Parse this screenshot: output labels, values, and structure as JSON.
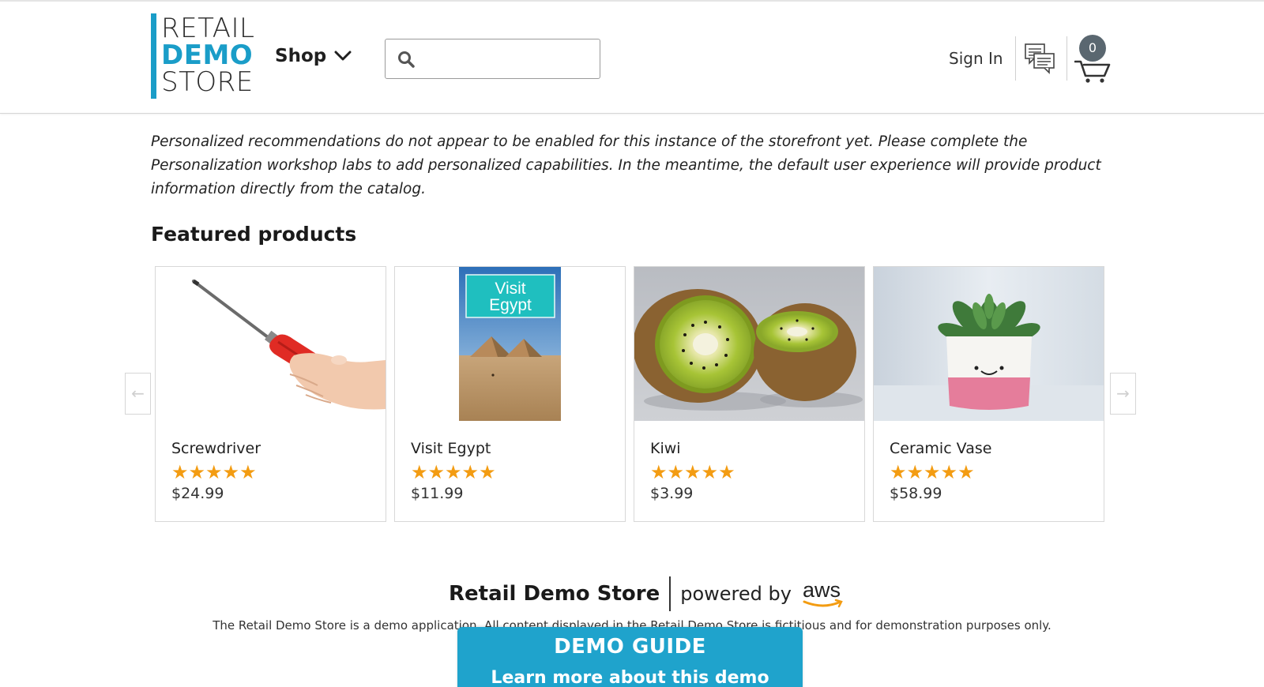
{
  "header": {
    "logo": {
      "line1": "RETAIL",
      "line2": "DEMO",
      "line3": "STORE"
    },
    "shop_label": "Shop",
    "search": {
      "placeholder": "",
      "value": ""
    },
    "signin_label": "Sign In",
    "cart_count": "0",
    "colors": {
      "brand": "#1a9dc8",
      "cart_badge": "#5a6770"
    }
  },
  "notice": "Personalized recommendations do not appear to be enabled for this instance of the storefront yet. Please complete the Personalization workshop labs to add personalized capabilities. In the meantime, the default user experience will provide product information directly from the catalog.",
  "featured": {
    "title": "Featured products",
    "prev_label": "←",
    "next_label": "→",
    "products": [
      {
        "name": "Screwdriver",
        "stars": "★★★★★",
        "rating": 5,
        "price": "$24.99",
        "image": "screwdriver-in-hand"
      },
      {
        "name": "Visit Egypt",
        "stars": "★★★★★",
        "rating": 5,
        "price": "$11.99",
        "image": "egypt-pyramids-book",
        "image_caption_1": "Visit",
        "image_caption_2": "Egypt"
      },
      {
        "name": "Kiwi",
        "stars": "★★★★★",
        "rating": 5,
        "price": "$3.99",
        "image": "kiwi-halves"
      },
      {
        "name": "Ceramic Vase",
        "stars": "★★★★★",
        "rating": 5,
        "price": "$58.99",
        "image": "succulent-in-vase"
      }
    ],
    "star_color": "#f39c12"
  },
  "footer": {
    "brand": "Retail Demo Store",
    "powered_by": "powered by",
    "aws_text": "aws",
    "disclaimer": "The Retail Demo Store is a demo application. All content displayed in the Retail Demo Store is fictitious and for demonstration purposes only."
  },
  "demo_guide": {
    "title": "DEMO GUIDE",
    "subtitle": "Learn more about this demo",
    "color": "#1fa3cc"
  }
}
